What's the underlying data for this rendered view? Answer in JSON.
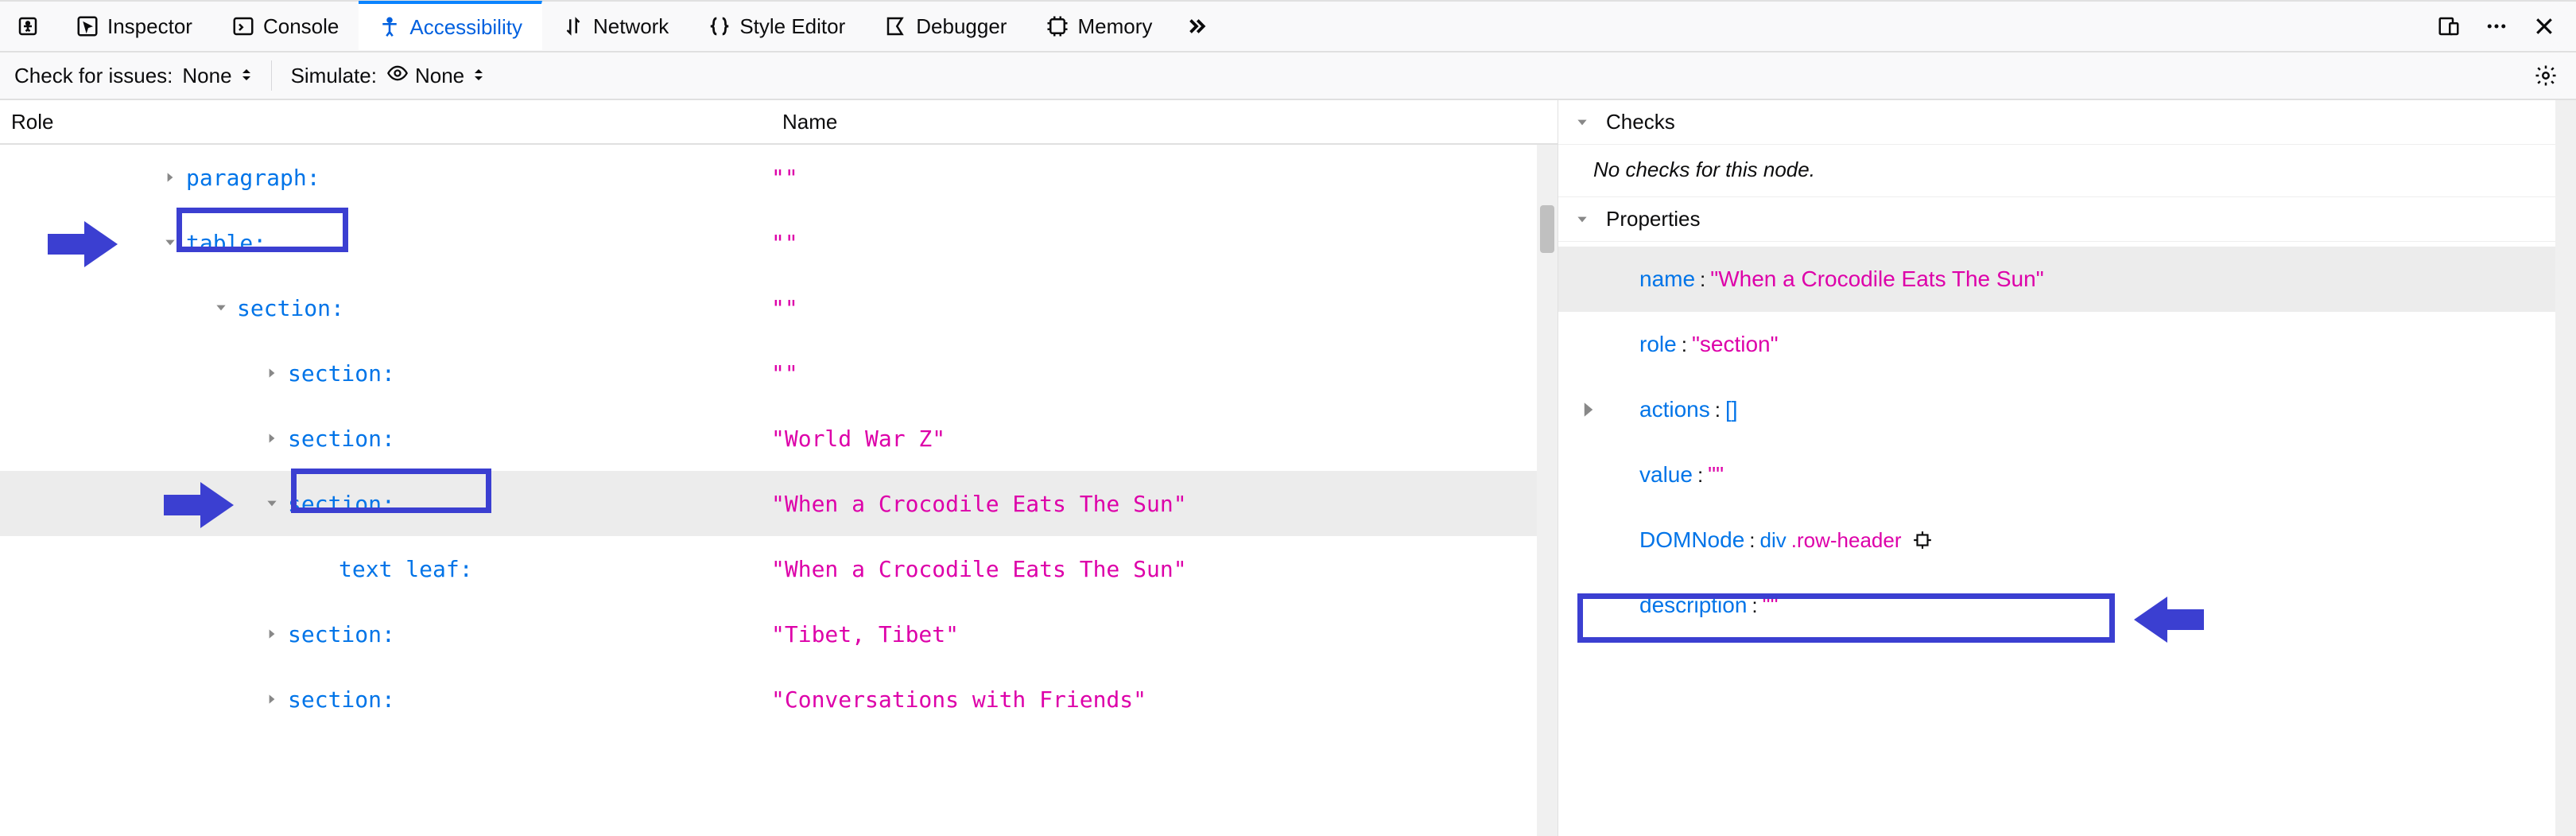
{
  "tabs": {
    "picker": "picker",
    "inspector": "Inspector",
    "console": "Console",
    "accessibility": "Accessibility",
    "network": "Network",
    "style_editor": "Style Editor",
    "debugger": "Debugger",
    "memory": "Memory"
  },
  "toolbar": {
    "check_label": "Check for issues:",
    "check_value": "None",
    "simulate_label": "Simulate:",
    "simulate_value": "None"
  },
  "tree": {
    "headers": {
      "role": "Role",
      "name": "Name"
    },
    "rows": [
      {
        "indent": 200,
        "twisty": "right",
        "role": "paragraph:",
        "name": "\"\"",
        "selected": false
      },
      {
        "indent": 200,
        "twisty": "down",
        "role": "table:",
        "name": "\"\"",
        "selected": false,
        "box": true
      },
      {
        "indent": 264,
        "twisty": "down",
        "role": "section:",
        "name": "\"\"",
        "selected": false
      },
      {
        "indent": 328,
        "twisty": "right",
        "role": "section:",
        "name": "\"\"",
        "selected": false
      },
      {
        "indent": 328,
        "twisty": "right",
        "role": "section:",
        "name": "\"World War Z\"",
        "selected": false
      },
      {
        "indent": 328,
        "twisty": "down",
        "role": "section:",
        "name": "\"When a Crocodile Eats The Sun\"",
        "selected": true,
        "box": true
      },
      {
        "indent": 392,
        "twisty": "none",
        "role": "text leaf:",
        "name": "\"When a Crocodile Eats The Sun\"",
        "selected": false
      },
      {
        "indent": 328,
        "twisty": "right",
        "role": "section:",
        "name": "\"Tibet, Tibet\"",
        "selected": false
      },
      {
        "indent": 328,
        "twisty": "right",
        "role": "section:",
        "name": "\"Conversations with Friends\"",
        "selected": false
      }
    ]
  },
  "checks": {
    "title": "Checks",
    "body": "No checks for this node."
  },
  "properties": {
    "title": "Properties",
    "rows": [
      {
        "key": "name",
        "type": "string",
        "val": "\"When a Crocodile Eats The Sun\"",
        "twisty": "none",
        "selected": true
      },
      {
        "key": "role",
        "type": "string",
        "val": "\"section\"",
        "twisty": "none"
      },
      {
        "key": "actions",
        "type": "brackets",
        "val": "[]",
        "twisty": "right"
      },
      {
        "key": "value",
        "type": "string",
        "val": "\"\"",
        "twisty": "none"
      },
      {
        "key": "DOMNode",
        "type": "domnode",
        "tag": "div",
        "cls": ".row-header",
        "twisty": "none",
        "box": true
      },
      {
        "key": "description",
        "type": "string",
        "val": "\"\"",
        "twisty": "none"
      }
    ]
  }
}
